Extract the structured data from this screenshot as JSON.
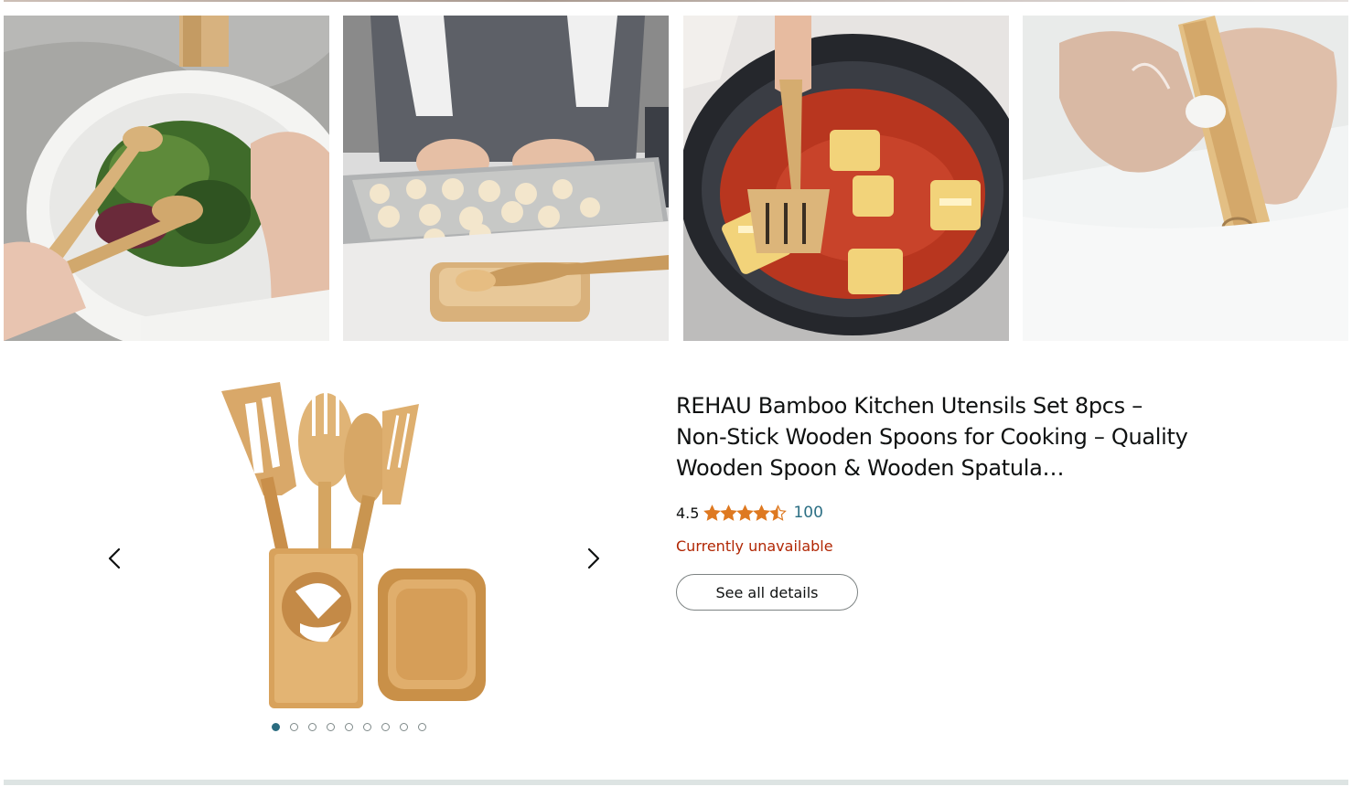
{
  "gallery": {
    "tiles": [
      {
        "icon": "salad-bowl-photo"
      },
      {
        "icon": "cookie-dough-photo"
      },
      {
        "icon": "ravioli-pan-photo"
      },
      {
        "icon": "washing-spatula-photo"
      }
    ]
  },
  "carousel": {
    "prev_icon": "chevron-left-icon",
    "next_icon": "chevron-right-icon",
    "total_images": 9,
    "active_index": 0
  },
  "product": {
    "title": "REHAU Bamboo Kitchen Utensils Set 8pcs – Non-Stick Wooden Spoons for Cooking – Quality Wooden Spoon & Wooden Spatula…",
    "rating": "4.5",
    "rating_stars": 4.5,
    "review_count": "100",
    "availability": "Currently unavailable",
    "details_button": "See all details"
  },
  "colors": {
    "star": "#de7921",
    "link": "#2c6f84",
    "unavailable": "#b12704",
    "active_dot": "#2b6c80"
  }
}
